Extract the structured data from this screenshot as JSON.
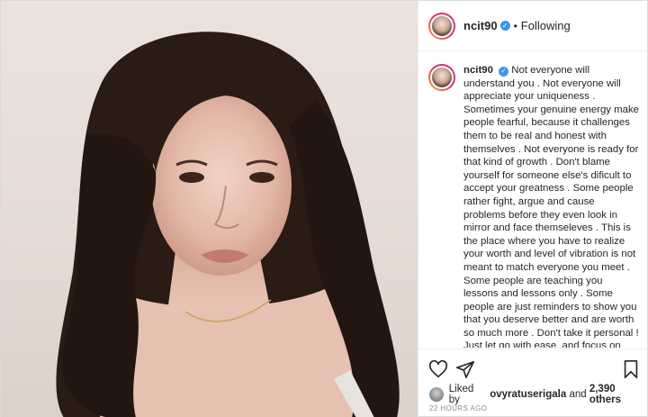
{
  "post": {
    "username": "ncit90",
    "follow_state": "Following",
    "separator": "•",
    "verified_glyph": "✓",
    "caption": "Not everyone will understand you . Not everyone will appreciate your uniqueness . Sometimes your genuine energy make people fearful, because it challenges them to be real and honest with themselves . Not everyone is ready for that kind of growth . Don't blame yourself for someone else's dificult to accept your greatness . Some people rather fight, argue and cause problems before they even look in mirror and face themseleves . This is the place where you have to realize your worth and level of vibration is not meant to match everyone you meet . Some people are teaching you lessons and lessons only . Some people are just reminders to show you that you deserve better and are worth so much more . Don't take it personal ! Just let go with ease, and focus on your inner peace 🙏",
    "likes_prefix": "Liked by",
    "liked_by_user": "ovyratuserigala",
    "likes_conjunction": "and",
    "likes_others": "2,390 others",
    "timestamp": "22 HOURS AGO"
  },
  "icons": {
    "like": "heart-icon",
    "share": "paper-plane-icon",
    "save": "bookmark-icon",
    "verified": "verified-badge-icon"
  },
  "colors": {
    "verified_blue": "#3897f0",
    "text": "#262626",
    "muted": "#8e8e8e",
    "border": "#dbdbdb"
  }
}
